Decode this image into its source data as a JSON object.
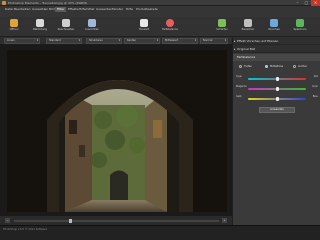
{
  "window": {
    "title": "Photoshop Elements – Tunnelbild.jpg @ 43% (RGB/8)",
    "minimize": "–",
    "maximize": "□",
    "close": "×"
  },
  "menu": [
    "Datei",
    "Bearbeiten",
    "Auswählen",
    "Bild",
    "Filter",
    "Effekte",
    "Hilfsmittel",
    "Auswerten",
    "Fenster",
    "Hilfe",
    "Produktpakete"
  ],
  "menu_active_index": 4,
  "toolbar": [
    {
      "label": "Öffnen",
      "icon": "folder-icon",
      "color": "#e0a43a"
    },
    {
      "label": "Belichtung",
      "icon": "exposure-icon",
      "color": "#d9d9d9"
    },
    {
      "label": "Zuschneiden",
      "icon": "crop-icon",
      "color": "#cfcfcf"
    },
    {
      "label": "Ausrichten",
      "icon": "rotate-icon",
      "color": "#9fb7d9"
    },
    {
      "label": "Tonwert",
      "icon": "levels-icon",
      "color": "#e8e8e8"
    },
    {
      "label": "Farbbalance",
      "icon": "color-wheel-icon",
      "color": "#e85d5d"
    },
    {
      "label": "Schärfen",
      "icon": "sharpen-icon",
      "color": "#7fbf5a"
    },
    {
      "label": "Rauschen",
      "icon": "noise-icon",
      "color": "#bfbfbf"
    },
    {
      "label": "Vorschau",
      "icon": "preview-icon",
      "color": "#6fa8dc"
    },
    {
      "label": "Speichern",
      "icon": "save-icon",
      "color": "#5ab85a"
    }
  ],
  "options": [
    {
      "label": "Linien"
    },
    {
      "label": "Standard"
    },
    {
      "label": "Strukturen"
    },
    {
      "label": "Kanten"
    },
    {
      "label": "Mittelwert"
    },
    {
      "label": "Normal"
    }
  ],
  "panel": {
    "tab1": "Effekt Vorschau auf Ebenen",
    "tab2": "Original Bild",
    "section_title": "Farbbalance",
    "radios": [
      {
        "label": "Tiefen",
        "selected": false
      },
      {
        "label": "Mitteltöne",
        "selected": true
      },
      {
        "label": "Lichter",
        "selected": false
      }
    ],
    "sliders": [
      {
        "label": "Cyan",
        "end": "Rot",
        "value": 0.5,
        "gradient": "linear-gradient(90deg,#00c8d8,#d83030)"
      },
      {
        "label": "Magenta",
        "end": "Grün",
        "value": 0.5,
        "gradient": "linear-gradient(90deg,#d030c8,#30c030)"
      },
      {
        "label": "Gelb",
        "end": "Blau",
        "value": 0.5,
        "gradient": "linear-gradient(90deg,#e0d020,#3040d8)"
      }
    ],
    "apply_button": "Anwenden"
  },
  "status": {
    "zoom_level": 0.27,
    "zoom_out": "−",
    "zoom_in": "+"
  },
  "footer": "PhotoShop v.5.0 © 2011 Software"
}
